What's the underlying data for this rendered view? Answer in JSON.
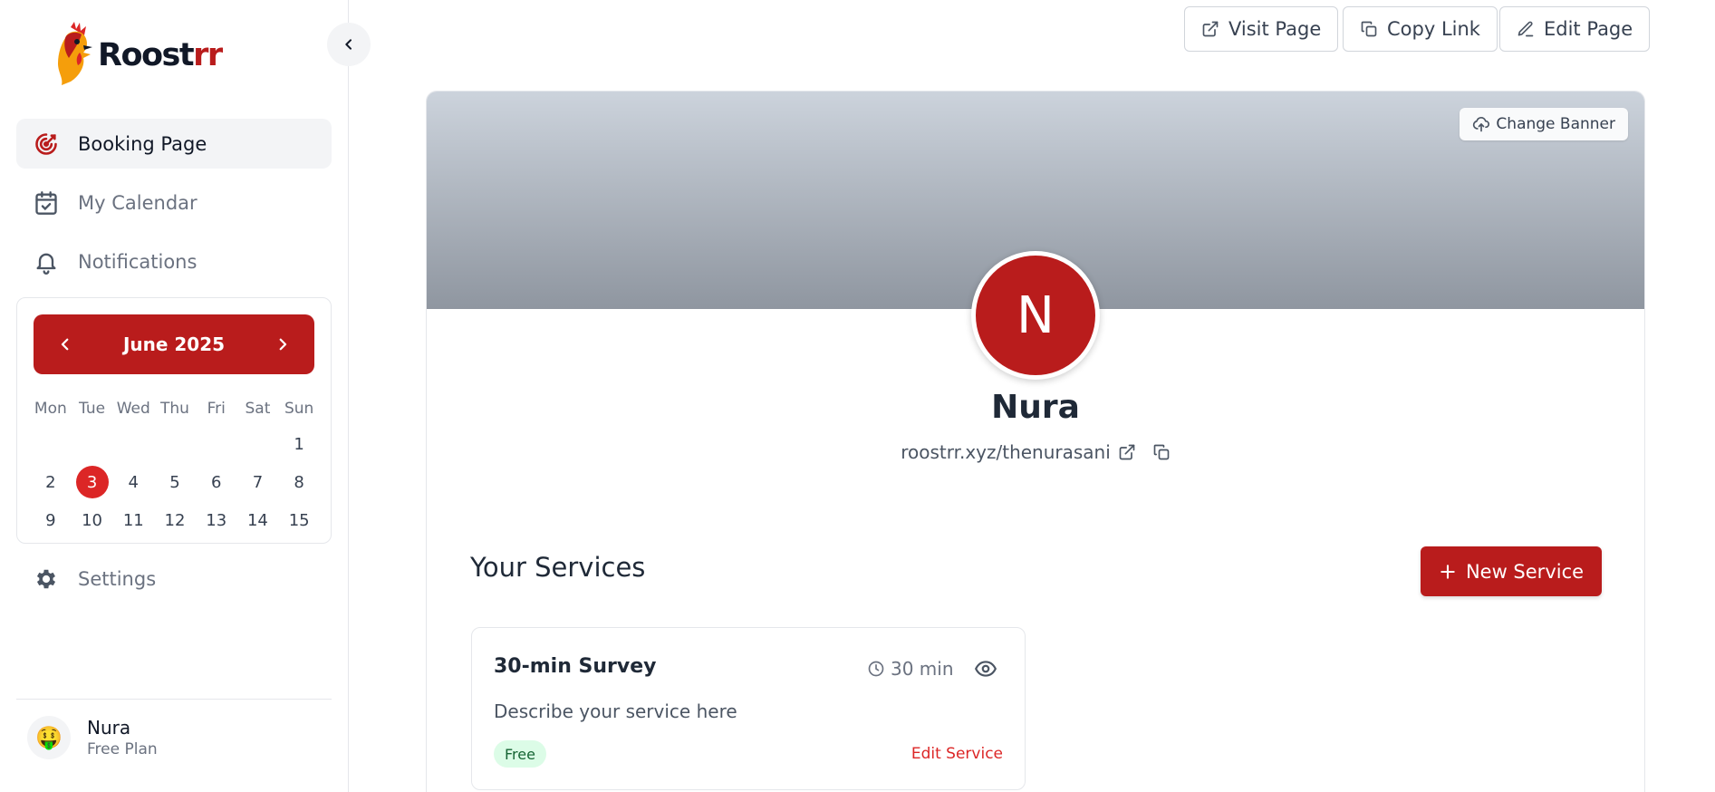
{
  "brand": {
    "name_main": "Roost",
    "name_accent": "rr",
    "accent_color": "#b91c1c"
  },
  "sidebar": {
    "nav": [
      {
        "label": "Booking Page",
        "icon": "target-icon",
        "active": true
      },
      {
        "label": "My Calendar",
        "icon": "calendar-check-icon",
        "active": false
      },
      {
        "label": "Notifications",
        "icon": "bell-icon",
        "active": false
      }
    ],
    "settings_label": "Settings",
    "calendar": {
      "month_label": "June 2025",
      "weekdays": [
        "Mon",
        "Tue",
        "Wed",
        "Thu",
        "Fri",
        "Sat",
        "Sun"
      ],
      "rows": [
        [
          "",
          "",
          "",
          "",
          "",
          "",
          "1"
        ],
        [
          "2",
          "3",
          "4",
          "5",
          "6",
          "7",
          "8"
        ],
        [
          "9",
          "10",
          "11",
          "12",
          "13",
          "14",
          "15"
        ]
      ],
      "today": "3"
    },
    "user": {
      "name": "Nura",
      "plan": "Free Plan",
      "avatar_emoji": "🤑"
    }
  },
  "top_actions": {
    "visit_page": "Visit Page",
    "copy_link": "Copy Link",
    "edit_page": "Edit Page"
  },
  "profile": {
    "change_banner": "Change Banner",
    "avatar_initial": "N",
    "name": "Nura",
    "url": "roostrr.xyz/thenurasani"
  },
  "services": {
    "title": "Your Services",
    "new_button": "New Service",
    "items": [
      {
        "title": "30-min Survey",
        "duration": "30 min",
        "description": "Describe your service here",
        "badge": "Free",
        "edit_label": "Edit Service"
      }
    ]
  }
}
